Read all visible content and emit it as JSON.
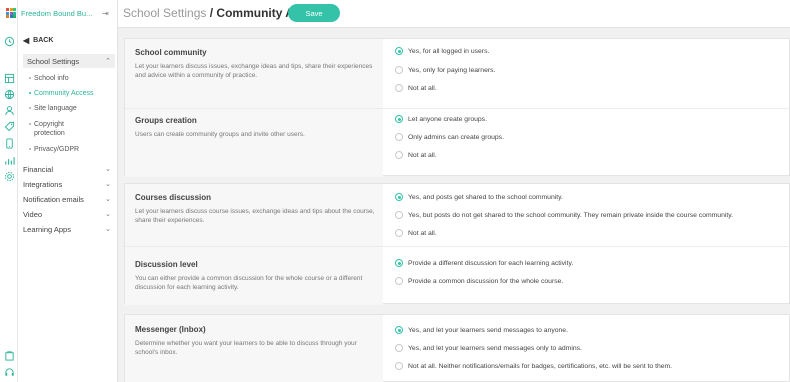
{
  "app": {
    "name": "Freedom Bound Bu...",
    "brand_color": "#2bb39a"
  },
  "header": {
    "parent": "School Settings",
    "separator": " / ",
    "current": "Community A...",
    "save_label": "Save"
  },
  "sidebar": {
    "back_label": "BACK",
    "section": {
      "label": "School Settings"
    },
    "sub_items": [
      {
        "label": "School info"
      },
      {
        "label": "Community Access"
      },
      {
        "label": "Site language"
      },
      {
        "label": "Copyright"
      },
      {
        "label": "protection"
      },
      {
        "label": "Privacy/GDPR"
      }
    ],
    "menu": [
      {
        "label": "Financial"
      },
      {
        "label": "Integrations"
      },
      {
        "label": "Notification emails"
      },
      {
        "label": "Video"
      },
      {
        "label": "Learning Apps"
      }
    ]
  },
  "settings": [
    {
      "title": "School community",
      "description": "Let your learners discuss issues, exchange ideas and tips, share their experiences and advice within a community of practice.",
      "options": [
        "Yes, for all logged in users.",
        "Yes, only for paying learners.",
        "Not at all."
      ],
      "selected": 0
    },
    {
      "title": "Groups creation",
      "description": "Users can create community groups and invite other users.",
      "options": [
        "Let anyone create groups.",
        "Only admins can create groups.",
        "Not at all."
      ],
      "selected": 0
    },
    {
      "title": "Courses discussion",
      "description": "Let your learners discuss course issues, exchange ideas and tips about the course, share their experiences.",
      "options": [
        "Yes, and posts get shared to the school community.",
        "Yes, but posts do not get shared to the school community. They remain private inside the course community.",
        "Not at all."
      ],
      "selected": 0
    },
    {
      "title": "Discussion level",
      "description": "You can either provide a common discussion for the whole course or a different discussion for each learning activity.",
      "options": [
        "Provide a different discussion for each learning activity.",
        "Provide a common discussion for the whole course."
      ],
      "selected": 0
    },
    {
      "title": "Messenger (Inbox)",
      "description": "Determine whether you want your learners to be able to discuss through your school's inbox.",
      "options": [
        "Yes, and let your learners send messages to anyone.",
        "Yes, and let your learners send messages only to admins.",
        "Not at all. Neither notifications/emails for badges, certifications, etc. will be sent to them."
      ],
      "selected": 0
    }
  ]
}
